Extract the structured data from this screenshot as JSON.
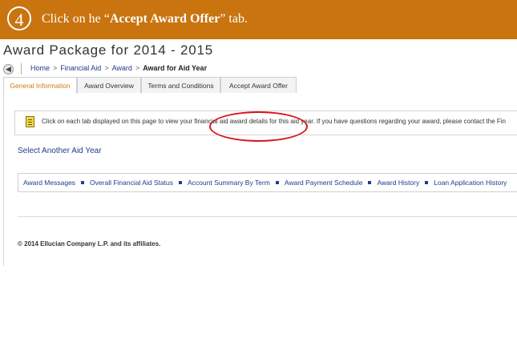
{
  "step": {
    "number": "4",
    "text_before": "Click on he “",
    "text_bold": "Accept Award Offer",
    "text_after": "” tab.",
    "banner_color": "#c9740f"
  },
  "page": {
    "title": "Award Package for 2014 - 2015"
  },
  "breadcrumb": {
    "items": [
      "Home",
      "Financial Aid",
      "Award",
      "Award for Aid Year"
    ],
    "separator": ">"
  },
  "tabs": [
    {
      "label": "General Information",
      "active": true
    },
    {
      "label": "Award Overview",
      "active": false
    },
    {
      "label": "Terms and Conditions",
      "active": false
    },
    {
      "label": "Accept Award Offer",
      "active": false
    }
  ],
  "message": {
    "icon": "note-icon",
    "text": "Click on each tab displayed on this page to view your financial aid award details for this aid year. If you have questions regarding your award, please contact the Fin"
  },
  "aid_year_link": "Select Another Aid Year",
  "links": [
    "Award Messages",
    "Overall Financial Aid Status",
    "Account Summary By Term",
    "Award Payment Schedule",
    "Award History",
    "Loan Application History"
  ],
  "footer": {
    "copyright": "© 2014 Ellucian Company L.P. and its affiliates."
  },
  "colors": {
    "link": "#1f3c8c",
    "active_tab": "#d0790e",
    "highlight": "#d9141b"
  }
}
